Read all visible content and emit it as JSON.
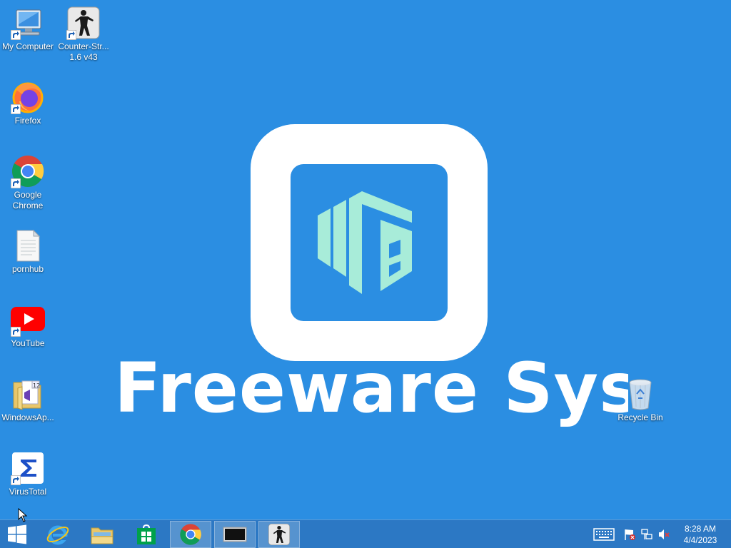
{
  "wallpaper": {
    "brand_text": "Freeware Sys"
  },
  "desktop": {
    "icons": [
      {
        "label": "My Computer",
        "icon": "my-computer-icon"
      },
      {
        "label": "Counter-Str...\n1.6 v43",
        "icon": "counter-strike-icon"
      },
      {
        "label": "Firefox",
        "icon": "firefox-icon"
      },
      {
        "label": "Google\nChrome",
        "icon": "chrome-icon"
      },
      {
        "label": "pornhub",
        "icon": "text-file-icon"
      },
      {
        "label": "YouTube",
        "icon": "youtube-icon"
      },
      {
        "label": "WindowsAp...",
        "icon": "folder-icon"
      },
      {
        "label": "VirusTotal",
        "icon": "virustotal-icon"
      },
      {
        "label": "Recycle Bin",
        "icon": "recycle-bin-icon"
      }
    ]
  },
  "taskbar": {
    "start": "start-icon",
    "pinned": [
      "internet-explorer-icon",
      "file-explorer-icon",
      "store-icon",
      "chrome-icon",
      "console-window-icon",
      "counter-strike-icon"
    ],
    "tray": [
      "keyboard-icon",
      "action-center-flag-icon",
      "network-icon",
      "volume-muted-icon"
    ],
    "clock": {
      "time": "8:28 AM",
      "date": "4/4/2023"
    }
  },
  "colors": {
    "desktop_bg": "#2b8ee2",
    "taskbar_bg": "#2c78c4",
    "logo_mint": "#a8ecd9"
  }
}
